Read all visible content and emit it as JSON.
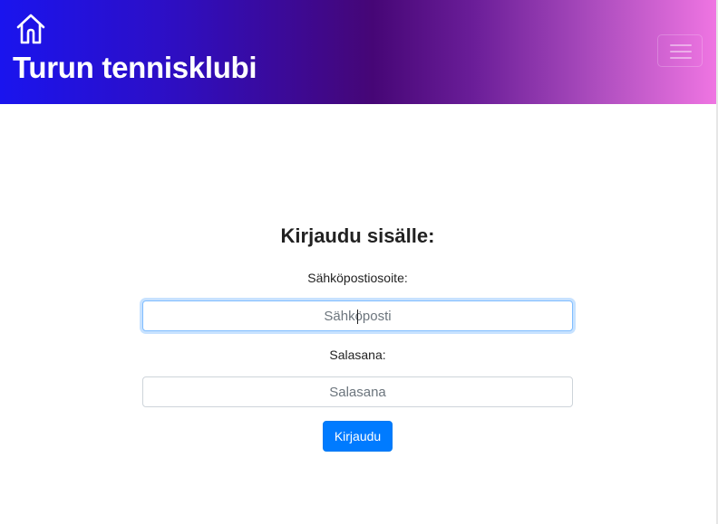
{
  "navbar": {
    "brand": "Turun tennisklubi",
    "home_icon": "home-icon",
    "menu_icon": "hamburger-menu-icon",
    "gradient_colors": [
      "#1a14ee",
      "#460676",
      "#ef75e2"
    ]
  },
  "login": {
    "title": "Kirjaudu sisälle:",
    "email_label": "Sähköpostiosoite:",
    "email_placeholder": "Sähköposti",
    "email_value": "",
    "password_label": "Salasana:",
    "password_placeholder": "Salasana",
    "password_value": "",
    "submit_label": "Kirjaudu"
  },
  "colors": {
    "primary": "#007bff",
    "focus_border": "#80bdff",
    "text": "#222222"
  }
}
